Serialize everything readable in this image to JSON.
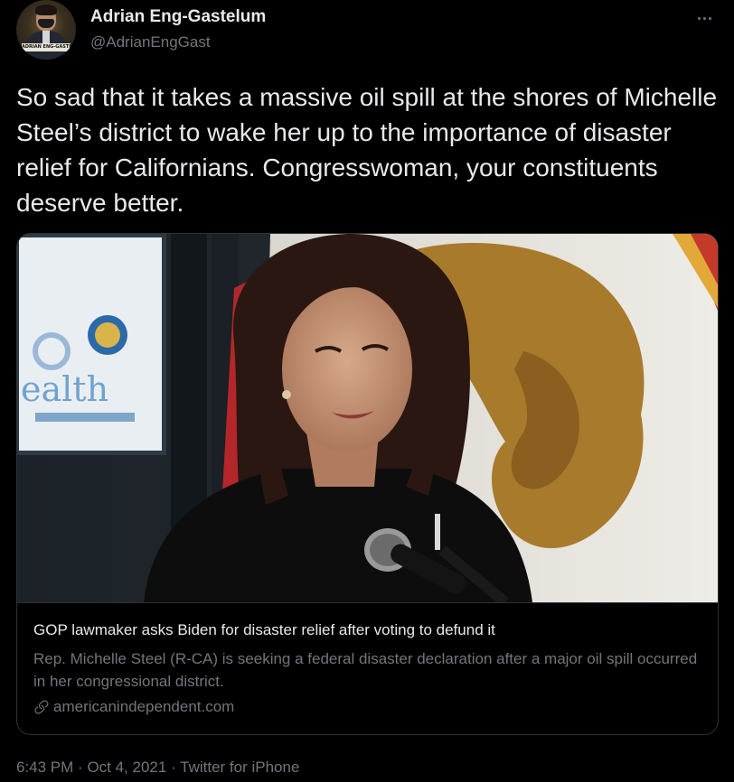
{
  "author": {
    "display_name": "Adrian Eng-Gastelum",
    "handle": "@AdrianEngGast",
    "avatar_nameplate": "ADRIAN ENG-GASTEL"
  },
  "tweet": {
    "text": "So sad that it takes a massive oil spill at the shores of Michelle Steel’s district to wake her up to the importance of disaster relief for Californians. Congresswoman, your constituents deserve better."
  },
  "card": {
    "image_icon": "photo-woman-at-podium",
    "image_sign_text": "ealth",
    "title": "GOP lawmaker asks Biden for disaster relief after voting to defund it",
    "description": "Rep. Michelle Steel (R-CA) is seeking a federal disaster declaration after a major oil spill occurred in her congressional district.",
    "domain": "americanindependent.com",
    "domain_icon": "link-icon"
  },
  "meta": {
    "time": "6:43 PM",
    "date": "Oct 4, 2021",
    "source": "Twitter for iPhone"
  },
  "colors": {
    "background": "#000000",
    "text_primary": "#e7e9ea",
    "text_secondary": "#71767b",
    "border": "#2f3336"
  }
}
